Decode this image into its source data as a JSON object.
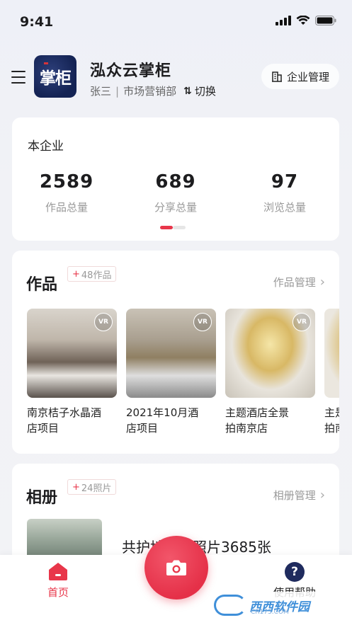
{
  "status_bar": {
    "time": "9:41"
  },
  "header": {
    "app_name": "泓众云掌柜",
    "logo_text": "掌柜",
    "user_name": "张三",
    "department": "市场营销部",
    "switch_label": "切换",
    "enterprise_button": "企业管理"
  },
  "stats": {
    "title": "本企业",
    "items": [
      {
        "value": "2589",
        "label": "作品总量"
      },
      {
        "value": "689",
        "label": "分享总量"
      },
      {
        "value": "97",
        "label": "浏览总量"
      }
    ],
    "page_indicator": {
      "count": 2,
      "active": 0
    }
  },
  "works": {
    "title": "作品",
    "badge": "48作品",
    "manage_label": "作品管理",
    "vr_label": "VR",
    "items": [
      {
        "caption_line1": "南京桔子水晶酒",
        "caption_line2": "店项目"
      },
      {
        "caption_line1": "2021年10月酒",
        "caption_line2": "店项目"
      },
      {
        "caption_line1": "主题酒店全景",
        "caption_line2": "拍南京店"
      },
      {
        "caption_line1": "主是",
        "caption_line2": "拍南"
      }
    ]
  },
  "album": {
    "title": "相册",
    "badge": "24照片",
    "manage_label": "相册管理",
    "count_text": "共护地……照片3685张"
  },
  "tab_bar": {
    "home_label": "首页",
    "help_label": "使用帮助",
    "accent": "#e8364a"
  },
  "watermark": {
    "text": "西西软件园",
    "url": "CR173.COM"
  }
}
